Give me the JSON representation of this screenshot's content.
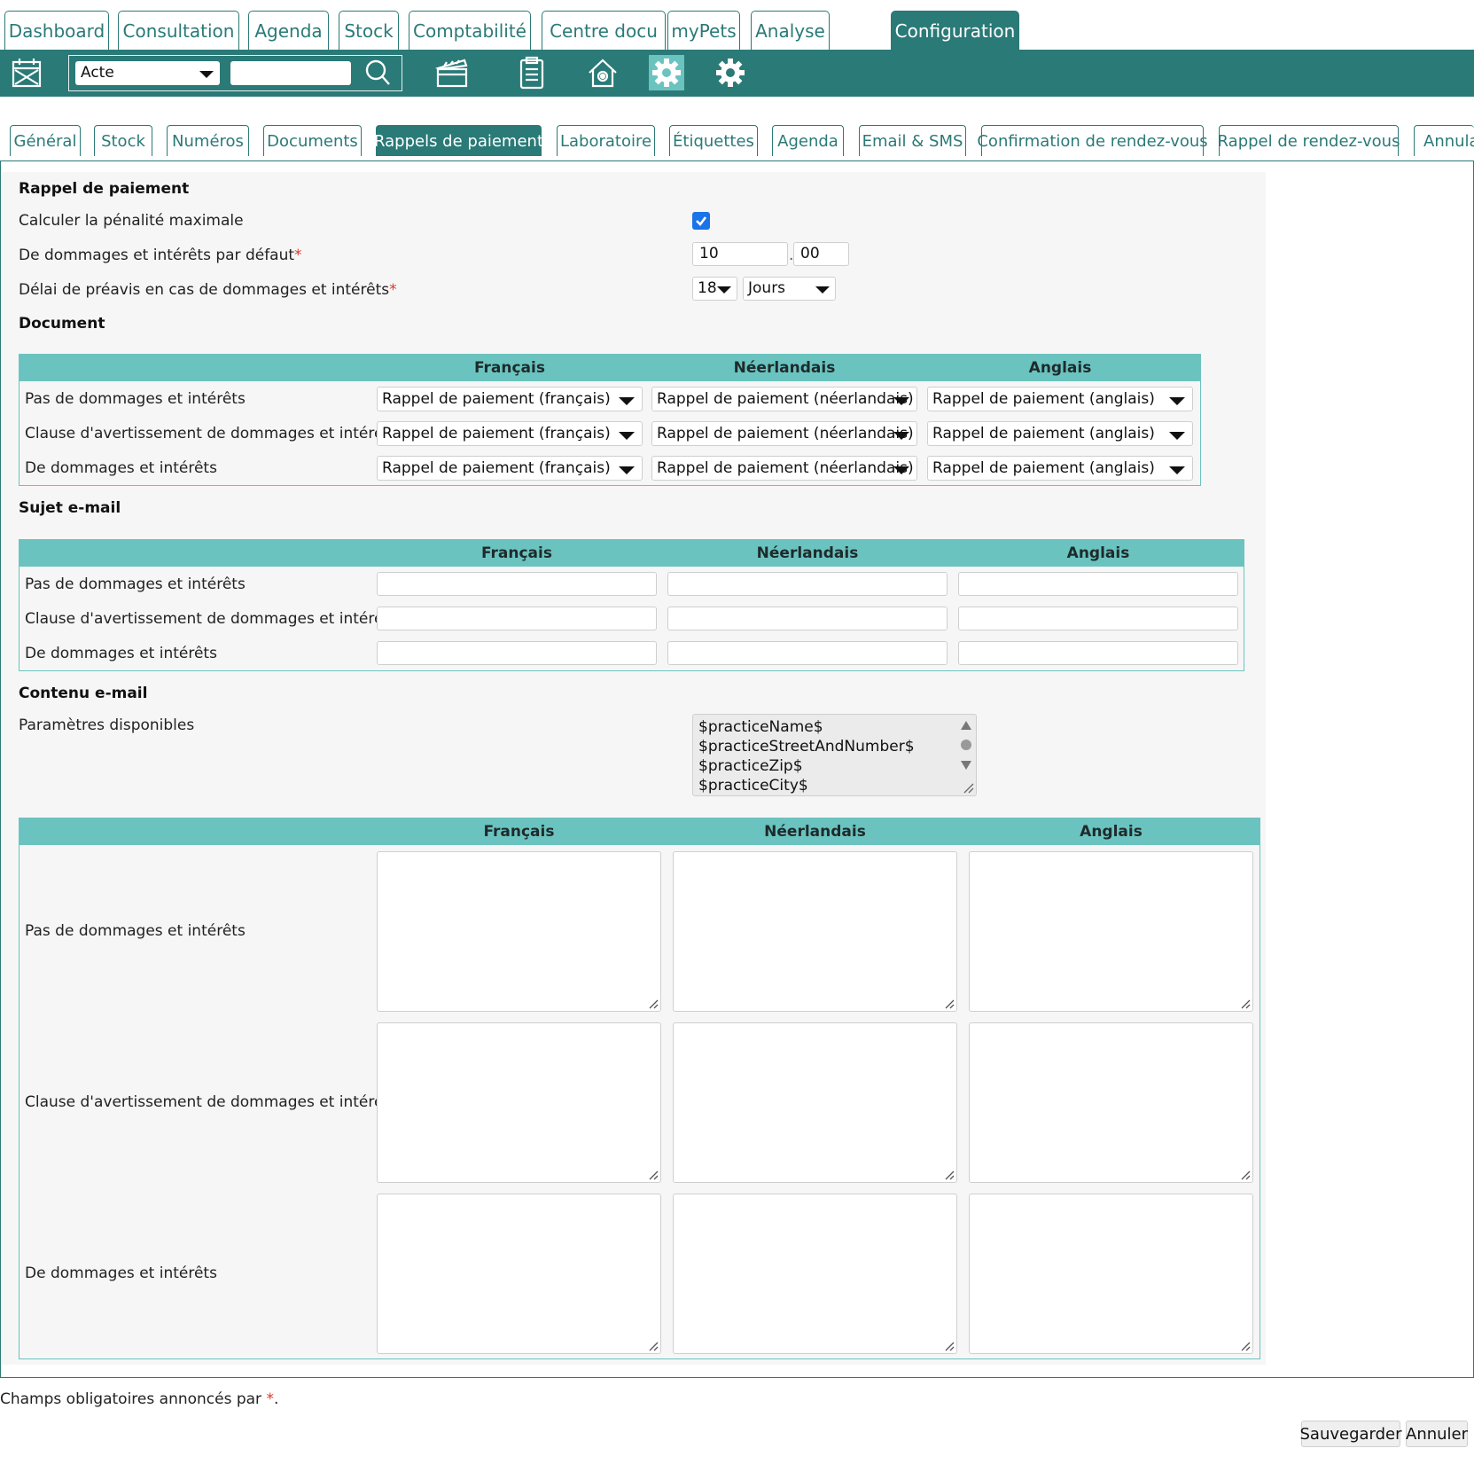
{
  "top_tabs": [
    {
      "label": "Dashboard"
    },
    {
      "label": "Consultation"
    },
    {
      "label": "Agenda"
    },
    {
      "label": "Stock"
    },
    {
      "label": "Comptabilité"
    },
    {
      "label": "Centre docu"
    },
    {
      "label": "myPets"
    },
    {
      "label": "Analyse"
    },
    {
      "label": "Configuration",
      "active": true
    }
  ],
  "toolbar": {
    "search_type": "Acte",
    "search_value": "",
    "icons": [
      "calendar-icon",
      "search-icon",
      "clapperboard-icon",
      "clipboard-icon",
      "house-gear-icon",
      "gear-settings-icon",
      "gear-icon"
    ]
  },
  "sub_tabs": [
    {
      "label": "Général"
    },
    {
      "label": "Stock"
    },
    {
      "label": "Numéros"
    },
    {
      "label": "Documents"
    },
    {
      "label": "Rappels de paiement",
      "active": true
    },
    {
      "label": "Laboratoire"
    },
    {
      "label": "Étiquettes"
    },
    {
      "label": "Agenda"
    },
    {
      "label": "Email & SMS"
    },
    {
      "label": "Confirmation de rendez-vous"
    },
    {
      "label": "Rappel de rendez-vous"
    },
    {
      "label": "Annula"
    }
  ],
  "payment_reminder": {
    "title": "Rappel de paiement",
    "max_penalty_label": "Calculer la pénalité maximale",
    "max_penalty_checked": true,
    "default_damages_label": "De dommages et intérêts par défaut",
    "default_damages_int": "10",
    "default_damages_sep": ".",
    "default_damages_dec": "00",
    "notice_label": "Délai de préavis en cas de dommages et intérêts",
    "notice_value": "18",
    "notice_unit": "Jours",
    "required_mark": "*"
  },
  "languages": [
    "Français",
    "Néerlandais",
    "Anglais"
  ],
  "row_labels": [
    "Pas de dommages et intérêts",
    "Clause d'avertissement de dommages et intérêts",
    "De dommages et intérêts"
  ],
  "document": {
    "title": "Document",
    "selected": [
      "Rappel de paiement (français)",
      "Rappel de paiement (néerlandais)",
      "Rappel de paiement (anglais)"
    ]
  },
  "email_subject": {
    "title": "Sujet e-mail",
    "values": [
      [
        "",
        "",
        ""
      ],
      [
        "",
        "",
        ""
      ],
      [
        "",
        "",
        ""
      ]
    ]
  },
  "email_content": {
    "title": "Contenu e-mail",
    "params_label": "Paramètres disponibles",
    "params": [
      "$practiceName$",
      "$practiceStreetAndNumber$",
      "$practiceZip$",
      "$practiceCity$"
    ]
  },
  "footer": {
    "note": "Champs obligatoires annoncés par ",
    "note_mark": "*",
    "note_end": ".",
    "save_label": "Sauvegarder",
    "cancel_label": "Annuler"
  },
  "colors": {
    "primary": "#2a7a77",
    "header": "#6bc3c0",
    "required": "#d9382c",
    "checkbox": "#1a73e8"
  }
}
